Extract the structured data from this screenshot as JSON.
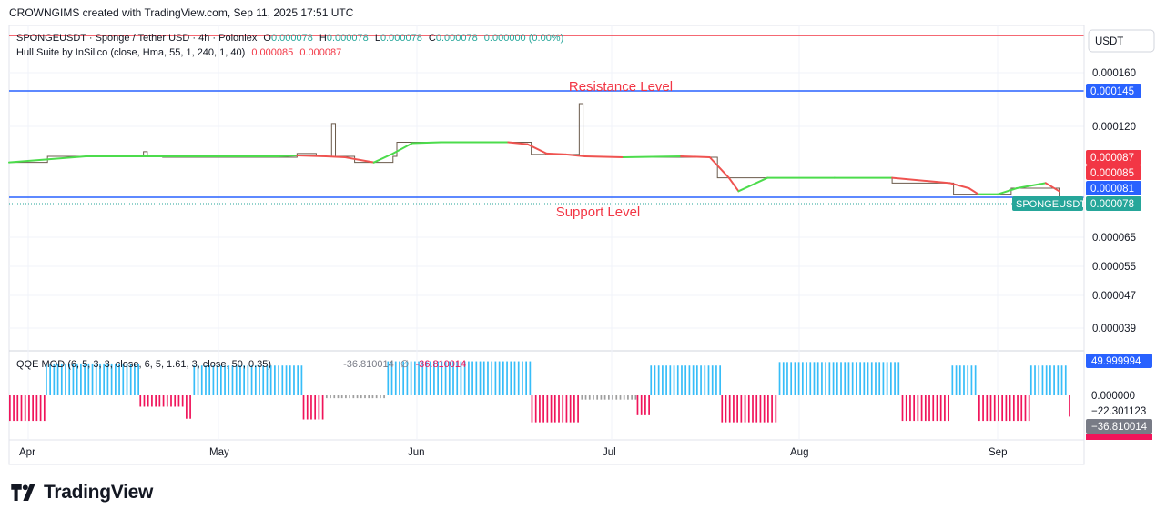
{
  "header": {
    "text": "CROWNGIMS created with TradingView.com, Sep 11, 2025 17:51 UTC"
  },
  "legend": {
    "symbol": "SPONGEUSDT · Sponge / Tether USD · 4h · Poloniex",
    "o_label": "O",
    "o_val": "0.000078",
    "h_label": "H",
    "h_val": "0.000078",
    "l_label": "L",
    "l_val": "0.000078",
    "c_label": "C",
    "c_val": "0.000078",
    "change": "0.000000 (0.00%)",
    "indicator": "Hull Suite by InSilico (close, Hma, 55, 1, 240, 1, 40)",
    "hull_v1": "0.000085",
    "hull_v2": "0.000087",
    "qqe": "QQE MOD (6, 5, 3, 3, close, 6, 5, 1.61, 3, close, 50, 0.35)",
    "qqe_v1": "-36.810014",
    "qqe_sym": "∅",
    "qqe_v2": "-36.810014"
  },
  "annotations": {
    "resistance": "Resistance Level",
    "support": "Support Level"
  },
  "currency": "USDT",
  "chart_data": {
    "type": "line",
    "x_ticks": [
      "Apr",
      "May",
      "Jun",
      "Jul",
      "Aug",
      "Sep"
    ],
    "y_ticks": [
      "0.000160",
      "0.000120",
      "0.000065",
      "0.000055",
      "0.000047",
      "0.000039"
    ],
    "price_labels": [
      {
        "label": "0.000145",
        "value": 0.000145,
        "color": "#2962ff"
      },
      {
        "label": "0.000087",
        "value": 8.7e-05,
        "color": "#f23645"
      },
      {
        "label": "0.000085",
        "value": 8.5e-05,
        "color": "#f23645"
      },
      {
        "label": "0.000081",
        "value": 8.1e-05,
        "color": "#2962ff"
      },
      {
        "label": "0.000078",
        "value": 7.8e-05,
        "color": "#26a69a"
      }
    ],
    "symbol_tag": "SPONGEUSDT",
    "resistance": 0.000145,
    "support": 8e-05,
    "top_line": 0.000175,
    "price": [
      [
        0,
        8.6e-05
      ],
      [
        20,
        8.8e-05
      ],
      [
        40,
        8.8e-05
      ],
      [
        60,
        8.8e-05
      ],
      [
        70,
        9.3e-05
      ],
      [
        72,
        8.8e-05
      ],
      [
        80,
        8.7e-05
      ],
      [
        100,
        8.7e-05
      ],
      [
        120,
        8.7e-05
      ],
      [
        140,
        8.7e-05
      ],
      [
        150,
        9.1e-05
      ],
      [
        160,
        8.8e-05
      ],
      [
        168,
        0.000122
      ],
      [
        170,
        8.8e-05
      ],
      [
        180,
        8.6e-05
      ],
      [
        195,
        8.6e-05
      ],
      [
        200,
        8.8e-05
      ],
      [
        202,
        0.000103
      ],
      [
        220,
        0.000103
      ],
      [
        240,
        0.000103
      ],
      [
        260,
        0.000103
      ],
      [
        270,
        0.000103
      ],
      [
        272,
        9e-05
      ],
      [
        285,
        9e-05
      ],
      [
        295,
        9e-05
      ],
      [
        297,
        0.000136
      ],
      [
        299,
        8.8e-05
      ],
      [
        310,
        8.7e-05
      ],
      [
        330,
        8.7e-05
      ],
      [
        350,
        8.7e-05
      ],
      [
        367,
        8.7e-05
      ],
      [
        369,
        8.3e-05
      ],
      [
        390,
        8.3e-05
      ],
      [
        420,
        8.3e-05
      ],
      [
        450,
        8.3e-05
      ],
      [
        460,
        8.2e-05
      ],
      [
        480,
        8.2e-05
      ],
      [
        490,
        8.2e-05
      ],
      [
        492,
        7.9e-05
      ],
      [
        510,
        7.9e-05
      ],
      [
        520,
        7.9e-05
      ],
      [
        522,
        8.1e-05
      ],
      [
        540,
        8.1e-05
      ],
      [
        545,
        8.1e-05
      ],
      [
        547,
        7.8e-05
      ]
    ],
    "hull": [
      [
        0,
        8.6e-05
      ],
      [
        40,
        8.8e-05
      ],
      [
        100,
        8.8e-05
      ],
      [
        140,
        8.8e-05
      ],
      [
        150,
        8.9e-05
      ],
      [
        165,
        8.8e-05
      ],
      [
        175,
        8.7e-05
      ],
      [
        190,
        8.6e-05
      ],
      [
        200,
        9.1e-05
      ],
      [
        210,
        0.000102
      ],
      [
        225,
        0.000103
      ],
      [
        260,
        0.000103
      ],
      [
        270,
        0.000101
      ],
      [
        280,
        9.1e-05
      ],
      [
        290,
        9e-05
      ],
      [
        300,
        8.8e-05
      ],
      [
        320,
        8.7e-05
      ],
      [
        350,
        8.8e-05
      ],
      [
        365,
        8.7e-05
      ],
      [
        375,
        8.3e-05
      ],
      [
        380,
        8e-05
      ],
      [
        395,
        8.3e-05
      ],
      [
        430,
        8.3e-05
      ],
      [
        460,
        8.3e-05
      ],
      [
        490,
        8.2e-05
      ],
      [
        500,
        8.1e-05
      ],
      [
        505,
        7.9e-05
      ],
      [
        515,
        7.9e-05
      ],
      [
        525,
        8.1e-05
      ],
      [
        540,
        8.2e-05
      ],
      [
        547,
        8e-05
      ]
    ],
    "qqe_labels": [
      {
        "label": "49.999994",
        "value": 50,
        "color": "#2962ff"
      },
      {
        "label": "0.000000",
        "value": 0,
        "color": null
      },
      {
        "label": "−22.301123",
        "value": -22.3,
        "color": null
      },
      {
        "label": "−36.810014",
        "value": -36.8,
        "color": "#787b86"
      }
    ],
    "qqe_segments": [
      {
        "from": 0,
        "to": 19,
        "v": -36,
        "c": "#f0145a"
      },
      {
        "from": 19,
        "to": 68,
        "v": 45,
        "c": "#37bdf8"
      },
      {
        "from": 68,
        "to": 92,
        "v": -16,
        "c": "#f0145a"
      },
      {
        "from": 92,
        "to": 96,
        "v": -33,
        "c": "#f0145a"
      },
      {
        "from": 96,
        "to": 153,
        "v": 42,
        "c": "#37bdf8"
      },
      {
        "from": 153,
        "to": 165,
        "v": -34,
        "c": "#f0145a"
      },
      {
        "from": 165,
        "to": 197,
        "v": -4,
        "c": "#9e9e9e"
      },
      {
        "from": 197,
        "to": 272,
        "v": 48,
        "c": "#37bdf8"
      },
      {
        "from": 272,
        "to": 298,
        "v": -38,
        "c": "#f0145a"
      },
      {
        "from": 298,
        "to": 327,
        "v": -6,
        "c": "#9e9e9e"
      },
      {
        "from": 327,
        "to": 334,
        "v": -28,
        "c": "#f0145a"
      },
      {
        "from": 334,
        "to": 371,
        "v": 42,
        "c": "#37bdf8"
      },
      {
        "from": 371,
        "to": 401,
        "v": -38,
        "c": "#f0145a"
      },
      {
        "from": 401,
        "to": 465,
        "v": 47,
        "c": "#37bdf8"
      },
      {
        "from": 465,
        "to": 491,
        "v": -36,
        "c": "#f0145a"
      },
      {
        "from": 491,
        "to": 505,
        "v": 42,
        "c": "#37bdf8"
      },
      {
        "from": 505,
        "to": 532,
        "v": -36,
        "c": "#f0145a"
      },
      {
        "from": 532,
        "to": 552,
        "v": 42,
        "c": "#37bdf8"
      },
      {
        "from": 552,
        "to": 554,
        "v": -30,
        "c": "#f0145a"
      }
    ]
  }
}
